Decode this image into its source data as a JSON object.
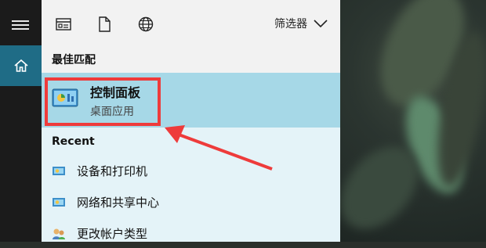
{
  "toolbar": {
    "filter_label": "筛选器",
    "icons": [
      "document-view-icon",
      "file-icon",
      "globe-icon",
      "chevron-down-icon"
    ]
  },
  "sections": {
    "best_match": "最佳匹配",
    "recent": "Recent"
  },
  "best_match": {
    "title": "控制面板",
    "subtitle": "桌面应用",
    "icon": "control-panel-icon"
  },
  "recent": {
    "items": [
      {
        "label": "设备和打印机",
        "icon": "devices-printers-icon"
      },
      {
        "label": "网络和共享中心",
        "icon": "network-sharing-icon"
      },
      {
        "label": "更改帐户类型",
        "icon": "user-accounts-icon"
      }
    ]
  },
  "colors": {
    "rail": "#1b1b1b",
    "home_active": "#1f6c86",
    "panel": "#f2f2f2",
    "best_match_bg": "#a6d8e7",
    "recent_bg": "#e4f3f8",
    "annotation": "#ee3b3b"
  }
}
